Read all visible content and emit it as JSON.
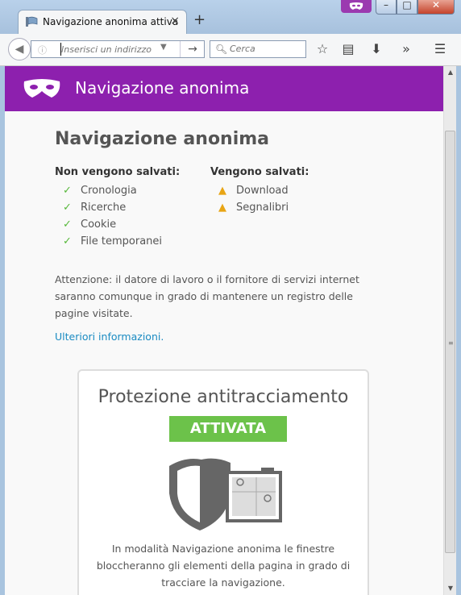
{
  "window": {
    "tab_title": "Navigazione anonima attiva",
    "close_tab": "×",
    "new_tab": "+",
    "win_min": "–",
    "win_max": "□",
    "win_close": "✕"
  },
  "toolbar": {
    "url_placeholder": "Inserisci un indirizzo o e",
    "search_placeholder": "Cerca",
    "icons": [
      "back-icon",
      "info-icon",
      "dropdown-icon",
      "go-arrow-icon",
      "search-icon",
      "star-icon",
      "reader-list-icon",
      "download-icon",
      "overflow-icon",
      "menu-icon"
    ]
  },
  "banner": {
    "title": "Navigazione anonima",
    "color": "#8d20ae"
  },
  "main": {
    "heading": "Navigazione anonima",
    "not_saved_title": "Non vengono salvati:",
    "not_saved": [
      "Cronologia",
      "Ricerche",
      "Cookie",
      "File temporanei"
    ],
    "saved_title": "Vengono salvati:",
    "saved": [
      "Download",
      "Segnalibri"
    ],
    "notice": "Attenzione: il datore di lavoro o il fornitore di servizi internet saranno comunque in grado di mantenere un registro delle pagine visitate.",
    "more_link": "Ulteriori informazioni."
  },
  "tracking": {
    "title": "Protezione antitracciamento",
    "status": "ATTIVATA",
    "status_color": "#6cc24a",
    "description": "In modalità Navigazione anonima le finestre bloccheranno gli elementi della pagina in grado di tracciare la navigazione."
  }
}
